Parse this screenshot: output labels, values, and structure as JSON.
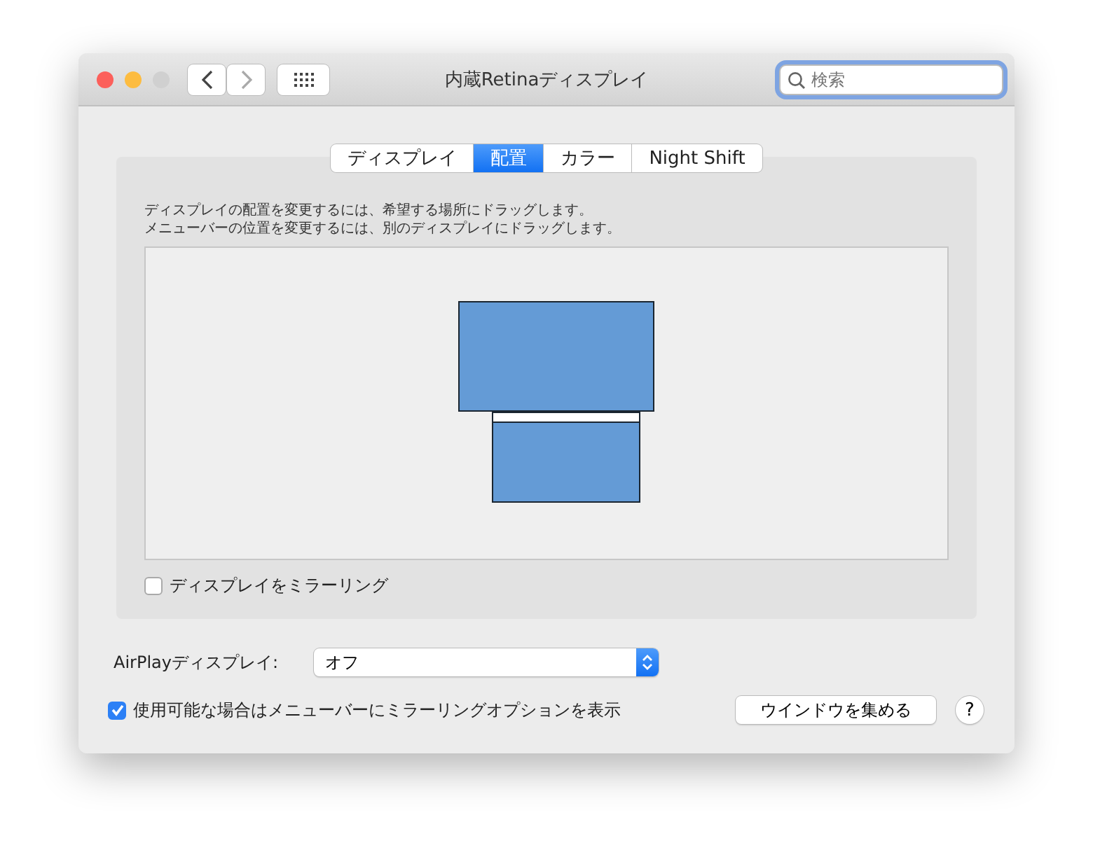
{
  "window": {
    "title": "内蔵Retinaディスプレイ",
    "traffic_lights": [
      {
        "kind": "close"
      },
      {
        "kind": "minimize"
      },
      {
        "kind": "zoom"
      }
    ]
  },
  "search": {
    "placeholder": "検索",
    "focused": true
  },
  "tabs": [
    {
      "label": "ディスプレイ",
      "selected": false
    },
    {
      "label": "配置",
      "selected": true
    },
    {
      "label": "カラー",
      "selected": false
    },
    {
      "label": "Night Shift",
      "selected": false
    }
  ],
  "instructions": [
    "ディスプレイの配置を変更するには、希望する場所にドラッグします。",
    "メニューバーの位置を変更するには、別のディスプレイにドラッグします。"
  ],
  "displays": [
    {
      "menu_bar": false
    },
    {
      "menu_bar": true
    }
  ],
  "mirror": {
    "label": "ディスプレイをミラーリング",
    "checked": false
  },
  "airplay": {
    "label": "AirPlayディスプレイ:",
    "value": "オフ"
  },
  "show_options": {
    "label": "使用可能な場合はメニューバーにミラーリングオプションを表示",
    "checked": true
  },
  "gather_button": "ウインドウを集める",
  "help": "?"
}
